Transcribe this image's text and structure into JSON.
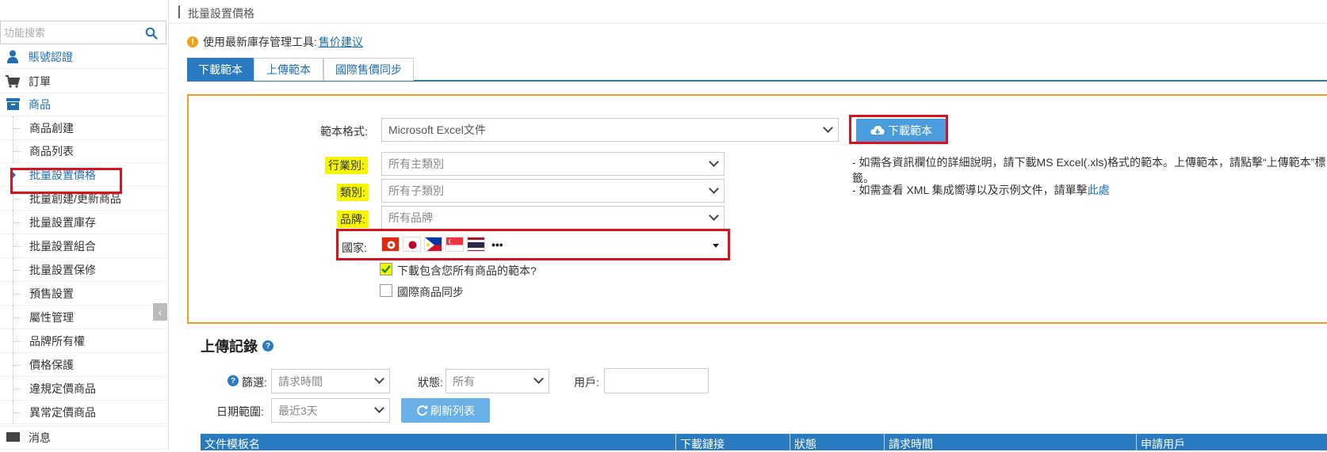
{
  "sidebar": {
    "search_placeholder": "功能搜索",
    "top_items": [
      {
        "label": "賬號認證",
        "icon": "user-icon"
      },
      {
        "label": "訂單",
        "icon": "cart-icon"
      },
      {
        "label": "商品",
        "icon": "box-icon"
      }
    ],
    "sub_items": [
      {
        "label": "商品創建"
      },
      {
        "label": "商品列表"
      },
      {
        "label": "批量設置價格"
      },
      {
        "label": "批量創建/更新商品"
      },
      {
        "label": "批量設置庫存"
      },
      {
        "label": "批量設置組合"
      },
      {
        "label": "批量設置保修"
      },
      {
        "label": "預售設置"
      },
      {
        "label": "屬性管理"
      },
      {
        "label": "品牌所有權"
      },
      {
        "label": "價格保護"
      },
      {
        "label": "違規定價商品"
      },
      {
        "label": "異常定價商品"
      }
    ],
    "next_top_item": "消息"
  },
  "breadcrumb": "批量設置價格",
  "notice": {
    "text": "使用最新庫存管理工具:",
    "link": "售价建议"
  },
  "tabs": [
    {
      "label": "下載範本",
      "active": true
    },
    {
      "label": "上傳範本",
      "active": false
    },
    {
      "label": "國際售價同步",
      "active": false
    }
  ],
  "form": {
    "format_label": "範本格式:",
    "format_value": "Microsoft Excel文件",
    "industry_label": "行業別:",
    "industry_value": "所有主類別",
    "category_label": "類別:",
    "category_value": "所有子類別",
    "brand_label": "品牌:",
    "brand_value": "所有品牌",
    "country_label": "國家:",
    "country_flags": [
      "hk-flag-icon",
      "jp-flag-icon",
      "ph-flag-icon",
      "sg-flag-icon",
      "th-flag-icon"
    ],
    "country_more": "•••",
    "include_all_label": "下載包含您所有商品的範本?",
    "include_all_checked": true,
    "intl_sync_label": "國際商品同步",
    "intl_sync_checked": false
  },
  "download_button": "下載範本",
  "help": {
    "line1": "- 如需各資訊欄位的詳細說明，請下載MS Excel(.xls)格式的範本。上傳範本，請點擊“上傳範本”標籤。",
    "line2_text": "- 如需查看 XML 集成嚮導以及示例文件，請單擊",
    "line2_link": "此處"
  },
  "upload_records": {
    "title": "上傳記錄",
    "filter_label": "篩選:",
    "filter_value": "請求時間",
    "status_label": "狀態:",
    "status_value": "所有",
    "user_label": "用戶:",
    "user_value": "",
    "date_label": "日期範圍:",
    "date_value": "最近3天",
    "refresh_button": "刷新列表",
    "columns": [
      "文件模板名",
      "下載鏈接",
      "狀態",
      "請求時間",
      "申請用戶"
    ]
  },
  "colors": {
    "primary_blue": "#2a7ac1",
    "highlight_yellow": "#f5f500",
    "panel_border": "#f0a020",
    "annotation_red": "#d9121b"
  }
}
